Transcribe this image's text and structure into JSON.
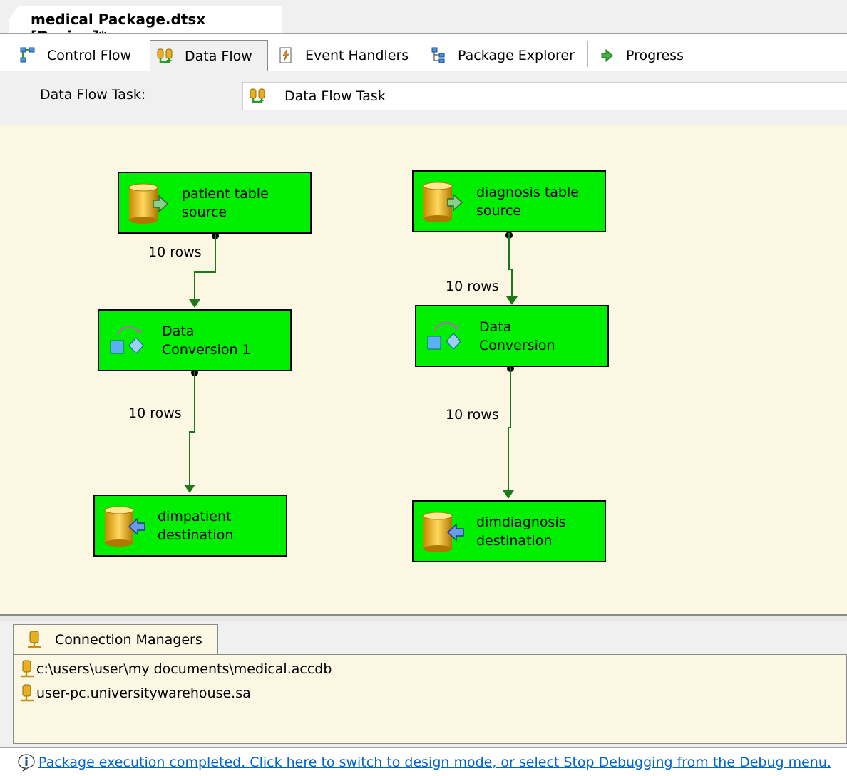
{
  "document_tab": {
    "title": "medical Package.dtsx [Design]*"
  },
  "designer_tabs": [
    {
      "label": "Control Flow",
      "icon": "control-flow-icon",
      "active": false
    },
    {
      "label": "Data Flow",
      "icon": "data-flow-icon",
      "active": true
    },
    {
      "label": "Event Handlers",
      "icon": "event-handlers-icon",
      "active": false
    },
    {
      "label": "Package Explorer",
      "icon": "package-explorer-icon",
      "active": false
    },
    {
      "label": "Progress",
      "icon": "progress-arrow-icon",
      "active": false
    }
  ],
  "task_bar": {
    "label": "Data Flow Task:",
    "selected": "Data Flow Task"
  },
  "canvas": {
    "nodes": [
      {
        "line1": "patient table",
        "line2": "source",
        "icon": "source-database-icon"
      },
      {
        "line1": "Data",
        "line2": "Conversion 1",
        "icon": "data-conversion-icon"
      },
      {
        "line1": "dimpatient",
        "line2": "destination",
        "icon": "destination-database-icon"
      },
      {
        "line1": "diagnosis table",
        "line2": "source",
        "icon": "source-database-icon"
      },
      {
        "line1": "Data",
        "line2": "Conversion",
        "icon": "data-conversion-icon"
      },
      {
        "line1": "dimdiagnosis",
        "line2": "destination",
        "icon": "destination-database-icon"
      }
    ],
    "path_labels": [
      "10 rows",
      "10 rows",
      "10 rows",
      "10 rows"
    ]
  },
  "connection_managers": {
    "tab_label": "Connection Managers",
    "items": [
      "c:\\users\\user\\my documents\\medical.accdb",
      "user-pc.universitywarehouse.sa"
    ]
  },
  "status": {
    "message": "Package execution completed. Click here to switch to design mode, or select Stop Debugging from the Debug menu."
  },
  "colors": {
    "node_fill": "#00ee00",
    "canvas_bg": "#fbf7e3",
    "path_green": "#1a7a1a",
    "link_blue": "#0066cc"
  }
}
